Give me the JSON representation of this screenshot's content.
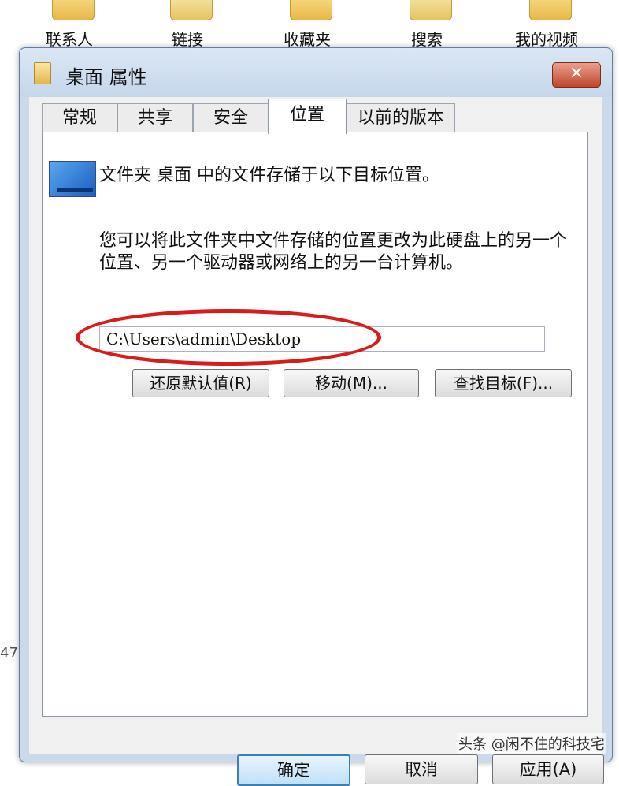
{
  "desktop": {
    "items": [
      {
        "label": "联系人"
      },
      {
        "label": "链接"
      },
      {
        "label": "收藏夹"
      },
      {
        "label": "搜索"
      },
      {
        "label": "我的视频"
      }
    ],
    "left_edge_text": "47"
  },
  "dialog": {
    "title": "桌面 属性",
    "close_glyph": "✕",
    "tabs": [
      {
        "label": "常规"
      },
      {
        "label": "共享"
      },
      {
        "label": "安全"
      },
      {
        "label": "位置",
        "active": true
      },
      {
        "label": "以前的版本"
      }
    ],
    "location": {
      "info": "文件夹 桌面 中的文件存储于以下目标位置。",
      "description": "您可以将此文件夹中文件存储的位置更改为此硬盘上的另一个位置、另一个驱动器或网络上的另一台计算机。",
      "path_value": "C:\\Users\\admin\\Desktop",
      "restore_button": "还原默认值(R)",
      "move_button": "移动(M)...",
      "find_target_button": "查找目标(F)..."
    },
    "buttons": {
      "ok": "确定",
      "cancel": "取消",
      "apply": "应用(A)"
    }
  },
  "colors": {
    "annotation_oval": "#d81c1c",
    "title_bar": "#cbd9ea",
    "close_button": "#c0452b"
  },
  "watermark": "头条 @闲不住的科技宅"
}
